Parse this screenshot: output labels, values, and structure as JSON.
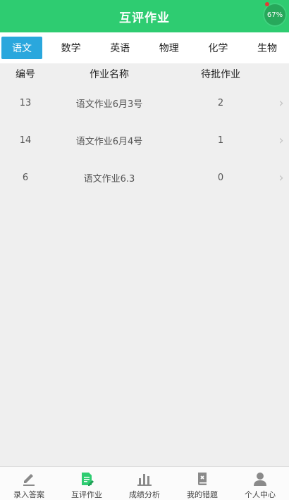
{
  "header": {
    "title": "互评作业",
    "badge": "67%"
  },
  "tabs": [
    {
      "label": "语文",
      "active": true
    },
    {
      "label": "数学",
      "active": false
    },
    {
      "label": "英语",
      "active": false
    },
    {
      "label": "物理",
      "active": false
    },
    {
      "label": "化学",
      "active": false
    },
    {
      "label": "生物",
      "active": false
    }
  ],
  "table": {
    "columns": [
      "编号",
      "作业名称",
      "待批作业"
    ],
    "rows": [
      {
        "id": "13",
        "name": "语文作业6月3号",
        "pending": "2"
      },
      {
        "id": "14",
        "name": "语文作业6月4号",
        "pending": "1"
      },
      {
        "id": "6",
        "name": "语文作业6.3",
        "pending": "0"
      }
    ]
  },
  "nav": [
    {
      "label": "录入答案",
      "icon": "pencil-icon"
    },
    {
      "label": "互评作业",
      "icon": "document-edit-icon",
      "active": true
    },
    {
      "label": "成绩分析",
      "icon": "bar-chart-icon"
    },
    {
      "label": "我的错题",
      "icon": "wrong-book-icon"
    },
    {
      "label": "个人中心",
      "icon": "person-icon"
    }
  ],
  "colors": {
    "header": "#2ecc71",
    "tab_active": "#2aa7dd",
    "nav_active": "#2ecc71",
    "nav_inactive": "#8a8a8a"
  }
}
